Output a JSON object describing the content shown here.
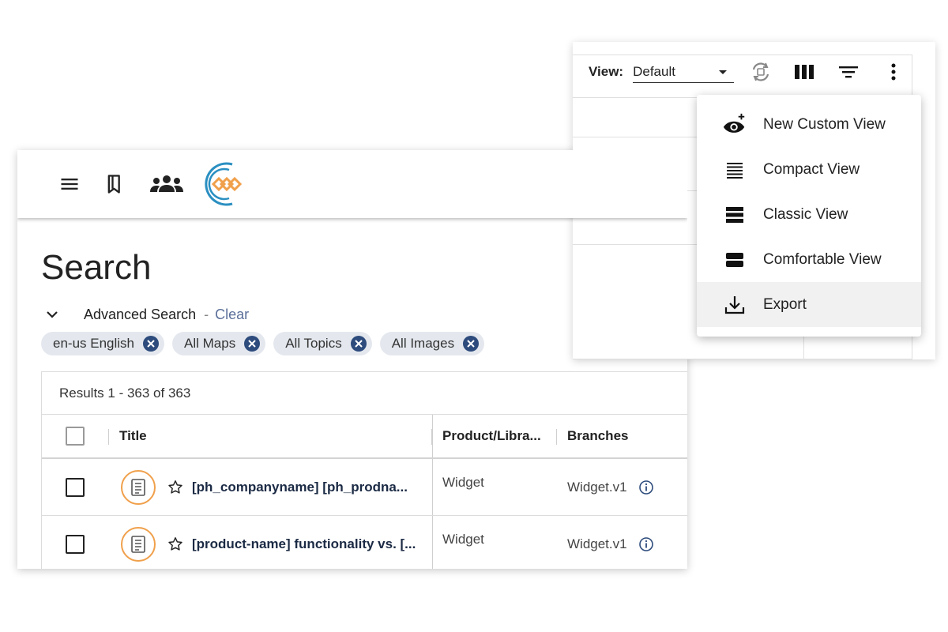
{
  "header": {
    "icons": [
      "hamburger-icon",
      "bookmark-icon",
      "group-icon",
      "logo-icon"
    ]
  },
  "page": {
    "title": "Search"
  },
  "advanced_search": {
    "label": "Advanced Search",
    "separator": "-",
    "clear_label": "Clear"
  },
  "chips": [
    {
      "label": "en-us English"
    },
    {
      "label": "All Maps"
    },
    {
      "label": "All Topics"
    },
    {
      "label": "All Images"
    }
  ],
  "results": {
    "summary": "Results 1 - 363 of 363",
    "columns": [
      "Title",
      "Product/Libra...",
      "Branches"
    ],
    "rows": [
      {
        "title": "[ph_companyname] [ph_prodna...",
        "product": "Widget",
        "branch": "Widget.v1"
      },
      {
        "title": "[product-name] functionality vs. [...",
        "product": "Widget",
        "branch": "Widget.v1"
      }
    ]
  },
  "view_toolbar": {
    "label": "View:",
    "selected": "Default"
  },
  "view_menu": {
    "items": [
      {
        "label": "New Custom View",
        "icon": "eye-plus-icon"
      },
      {
        "label": "Compact View",
        "icon": "compact-view-icon"
      },
      {
        "label": "Classic View",
        "icon": "classic-view-icon"
      },
      {
        "label": "Comfortable View",
        "icon": "comfortable-view-icon"
      },
      {
        "label": "Export",
        "icon": "download-icon",
        "highlighted": true
      }
    ]
  },
  "colors": {
    "accent_orange": "#f0a04b",
    "logo_blue": "#2a8fc1",
    "link_blue": "#5b6f9a",
    "chip_bg": "#e4e8ee",
    "chip_close": "#2d4b7c"
  }
}
